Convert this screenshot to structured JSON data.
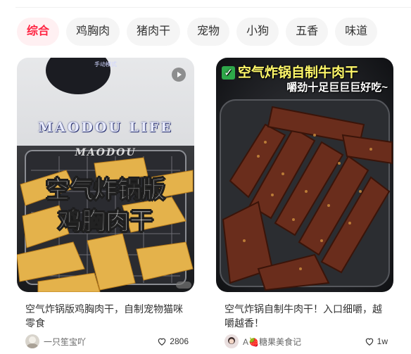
{
  "tabs": [
    {
      "label": "综合",
      "active": true
    },
    {
      "label": "鸡胸肉",
      "active": false
    },
    {
      "label": "猪肉干",
      "active": false
    },
    {
      "label": "宠物",
      "active": false
    },
    {
      "label": "小狗",
      "active": false
    },
    {
      "label": "五香",
      "active": false
    },
    {
      "label": "味道",
      "active": false
    }
  ],
  "colors": {
    "accent": "#ff2442",
    "tab_bg": "#f5f5f5",
    "active_tab_bg": "#fff0f2"
  },
  "notes": [
    {
      "cover_texts": {
        "lcd": "手动模式",
        "brand": "MAODOU LIFE",
        "signature": "MAODOU",
        "line1": "空气炸锅版",
        "line2": "鸡胸肉干"
      },
      "title": "空气炸锅版鸡胸肉干，自制宠物猫咪零食",
      "author": "一只笙宝吖",
      "likes": "2806",
      "is_video": true
    },
    {
      "cover_texts": {
        "line1": "空气炸锅自制牛肉干",
        "line2": "嚼劲十足巨巨巨好吃~"
      },
      "title": "空气炸锅自制牛肉干！入口细嚼，越嚼越香！",
      "author": "A🍓糖果美食记",
      "likes": "1w",
      "is_video": false
    }
  ]
}
